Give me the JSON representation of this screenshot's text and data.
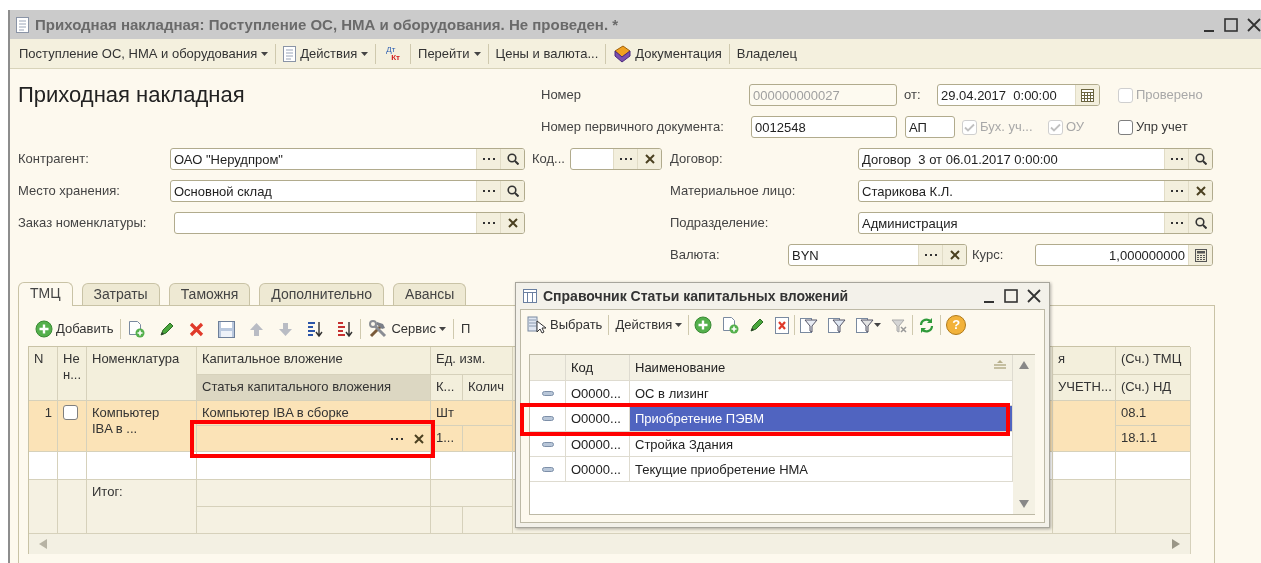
{
  "window": {
    "title": "Приходная накладная: Поступление ОС, НМА и оборудования. Не проведен. *"
  },
  "toolbar": [
    {
      "kind": "menu",
      "label": "Поступление ОС, НМА и оборудования"
    },
    {
      "kind": "icon-menu",
      "label": "Действия"
    },
    {
      "kind": "dtkt",
      "top": "Дт",
      "bottom": "Кт"
    },
    {
      "kind": "menu",
      "label": "Перейти"
    },
    {
      "kind": "link",
      "label": "Цены и валюта..."
    },
    {
      "kind": "icon-link",
      "label": "Документация"
    },
    {
      "kind": "link",
      "label": "Владелец"
    }
  ],
  "heading": "Приходная накладная",
  "number": {
    "label": "Номер",
    "value": "000000000027",
    "disabled": true
  },
  "date": {
    "label": "от:",
    "value": "29.04.2017  0:00:00"
  },
  "verified": {
    "label": "Проверено",
    "checked": false,
    "disabled": true
  },
  "primary_doc": {
    "label": "Номер первичного документа:",
    "value": "0012548",
    "series": "АП"
  },
  "flags": [
    {
      "label": "Бух. уч...",
      "checked": true,
      "disabled": true
    },
    {
      "label": "ОУ",
      "checked": true,
      "disabled": true
    },
    {
      "label": "Упр учет",
      "checked": false,
      "disabled": false
    }
  ],
  "left_fields": [
    {
      "label": "Контрагент:",
      "value": "ОАО \"Нерудпром\"",
      "kind": "lookup"
    },
    {
      "label": "Место хранения:",
      "value": "Основной склад",
      "kind": "lookup"
    },
    {
      "label": "Заказ номенклатуры:",
      "kind": "clearable"
    }
  ],
  "code_field": {
    "label": "Код...",
    "kind": "clearable"
  },
  "right_fields": [
    {
      "label": "Договор:",
      "value": "Договор  3 от 06.01.2017 0:00:00",
      "kind": "lookup"
    },
    {
      "label": "Материальное лицо:",
      "value": "Старикова К.Л.",
      "kind": "clearable"
    },
    {
      "label": "Подразделение:",
      "value": "Администрация",
      "kind": "lookup"
    }
  ],
  "currency": {
    "label": "Валюта:",
    "value": "BYN",
    "kind": "clearable"
  },
  "rate": {
    "label": "Курс:",
    "value": "1,000000000"
  },
  "tabs": [
    {
      "label": "ТМЦ",
      "selected": true
    },
    {
      "label": "Затраты",
      "selected": false
    },
    {
      "label": "Таможня",
      "selected": false
    },
    {
      "label": "Дополнительно",
      "selected": false
    },
    {
      "label": "Авансы",
      "selected": false
    }
  ],
  "table_toolbar": {
    "add": "Добавить",
    "service": "Сервис",
    "cut_button": "П"
  },
  "table": {
    "columns": [
      {
        "label": "N"
      },
      {
        "label": "Не н..."
      },
      {
        "label": "Номенклатура"
      },
      {
        "label": "Капитальное вложение",
        "sub_labels": [
          "Статья капитального вложения"
        ]
      },
      {
        "label": "Ед. изм.",
        "sub_labels": [
          "К...",
          "Колич"
        ]
      },
      {
        "label": "я",
        "sub_labels": [
          "УЧЕТН..."
        ]
      },
      {
        "label": "(Сч.) ТМЦ",
        "sub_labels": [
          "(Сч.) НД"
        ]
      }
    ],
    "rows": [
      {
        "number": "1",
        "selected": true,
        "checked": false,
        "item": "Компьютер IBA в ...",
        "investment": "Компьютер IBA в сборке",
        "article": {
          "highlighted": true
        },
        "unit": "Шт",
        "coefficient": "1...",
        "account": "08.1",
        "vat_account": "18.1.1"
      }
    ],
    "totals_label": "Итог:"
  },
  "dialog": {
    "title": "Справочник Статьи капитальных вложений",
    "select": "Выбрать",
    "actions": "Действия",
    "help": "?",
    "columns": [
      "Код",
      "Наименование"
    ],
    "rows": [
      {
        "code": "О0000...",
        "name": "ОС в лизинг",
        "selected": false,
        "highlighted": false
      },
      {
        "code": "О0000...",
        "name": "Приобретение ПЭВМ",
        "selected": true,
        "highlighted": true
      },
      {
        "code": "О0000...",
        "name": "Стройка Здания",
        "selected": false,
        "highlighted": false
      },
      {
        "code": "О0000...",
        "name": "Текущие приобретение НМА",
        "selected": false,
        "highlighted": false
      }
    ]
  }
}
